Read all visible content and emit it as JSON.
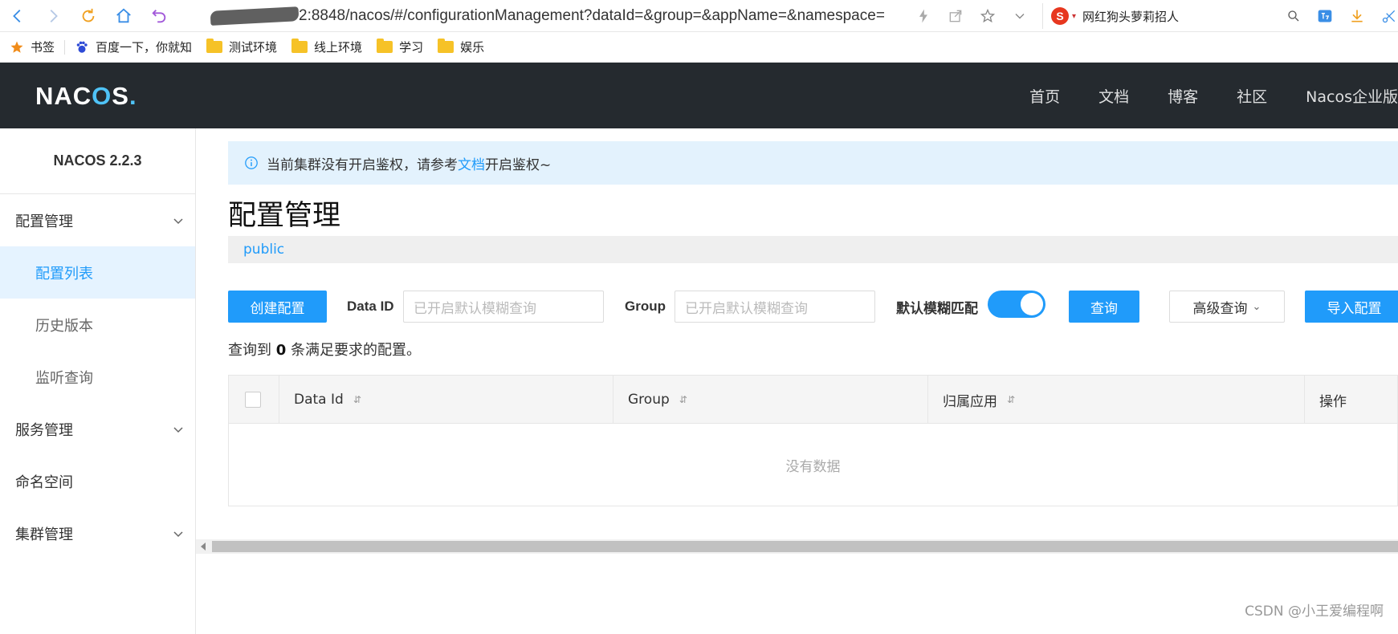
{
  "browser": {
    "url": "2:8848/nacos/#/configurationManagement?dataId=&group=&appName=&namespace=",
    "search_text": "网红狗头萝莉招人",
    "sogou_letter": "S",
    "caret": "▾"
  },
  "bookmarks": [
    {
      "label": "书签",
      "icon": "star-icon"
    },
    {
      "label": "百度一下，你就知",
      "icon": "baidu-icon"
    },
    {
      "label": "测试环境",
      "icon": "folder-icon"
    },
    {
      "label": "线上环境",
      "icon": "folder-icon"
    },
    {
      "label": "学习",
      "icon": "folder-icon"
    },
    {
      "label": "娱乐",
      "icon": "folder-icon"
    }
  ],
  "header": {
    "logo_pre": "NAC",
    "logo_o": "O",
    "logo_post": "S",
    "logo_dot": ".",
    "nav": [
      "首页",
      "文档",
      "博客",
      "社区",
      "Nacos企业版"
    ]
  },
  "sidebar": {
    "version": "NACOS 2.2.3",
    "groups": [
      {
        "label": "配置管理",
        "items": [
          "配置列表",
          "历史版本",
          "监听查询"
        ]
      },
      {
        "label": "服务管理"
      },
      {
        "label": "命名空间"
      },
      {
        "label": "集群管理"
      }
    ]
  },
  "main": {
    "notice_pre": "当前集群没有开启鉴权，请参考",
    "notice_link": "文档",
    "notice_post": "开启鉴权~",
    "title": "配置管理",
    "namespace": "public",
    "toolbar": {
      "create": "创建配置",
      "data_id_label": "Data ID",
      "data_id_placeholder": "已开启默认模糊查询",
      "group_label": "Group",
      "group_placeholder": "已开启默认模糊查询",
      "fuzzy_label": "默认模糊匹配",
      "fuzzy_on": true,
      "query": "查询",
      "advanced": "高级查询",
      "advanced_caret": "⌄",
      "import": "导入配置"
    },
    "result_pre": "查询到 ",
    "result_count": "0",
    "result_post": " 条满足要求的配置。",
    "table": {
      "columns": [
        "Data Id",
        "Group",
        "归属应用",
        "操作"
      ],
      "sort_glyph": "⇵",
      "empty": "没有数据"
    }
  },
  "watermark": "CSDN @小王爱编程啊",
  "colors": {
    "accent": "#209bfa",
    "header_bg": "#252a2f",
    "notice_bg": "#e3f2fd"
  }
}
